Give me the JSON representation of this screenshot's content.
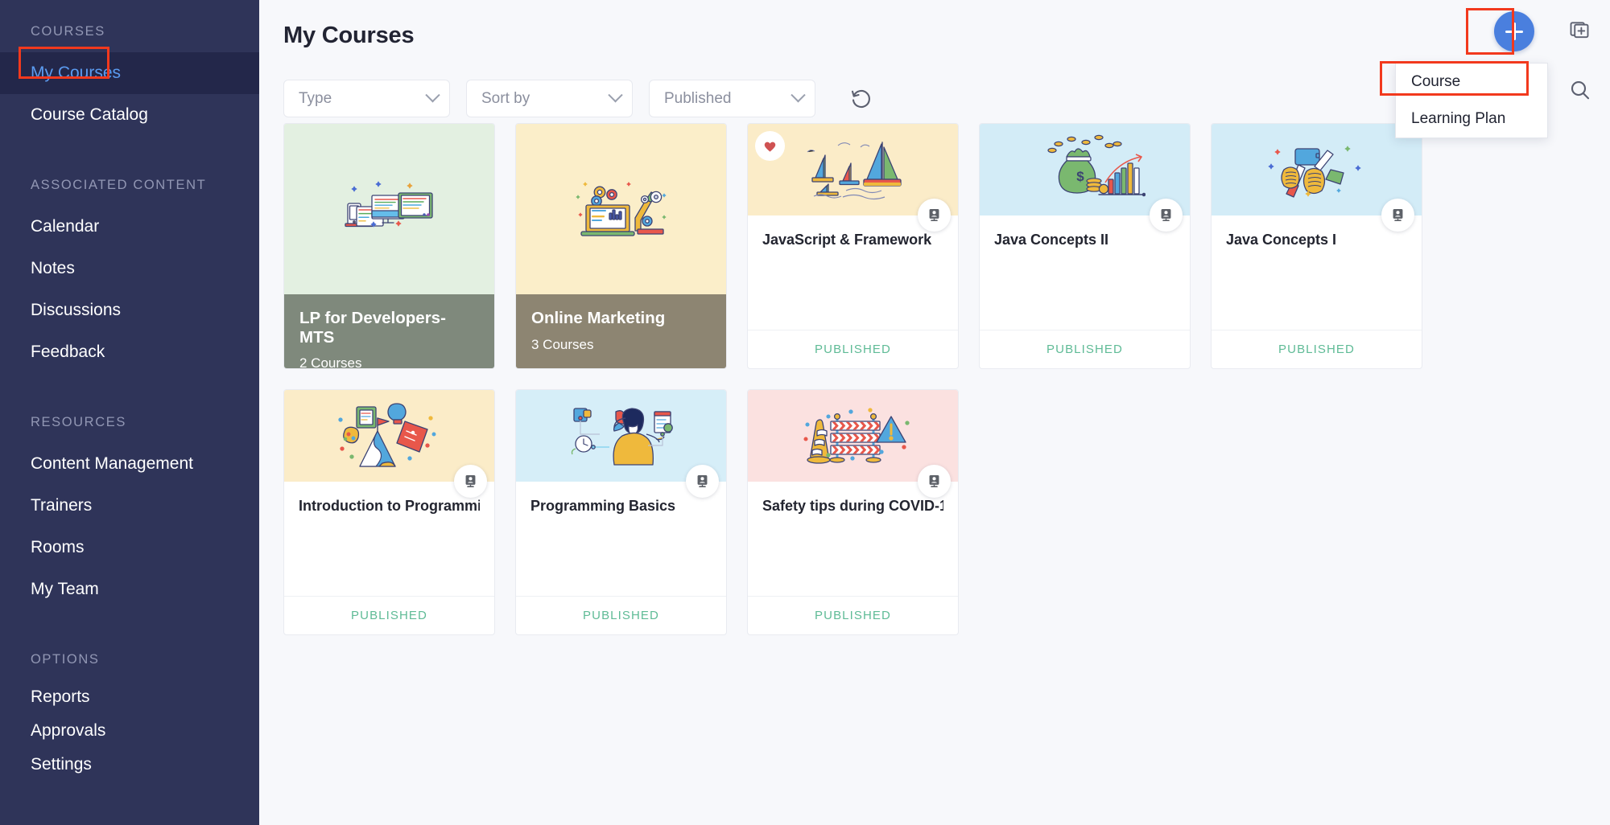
{
  "sidebar": {
    "groups": [
      {
        "label": "COURSES",
        "items": [
          {
            "label": "My Courses",
            "active": true
          },
          {
            "label": "Course Catalog",
            "active": false
          }
        ]
      },
      {
        "label": "ASSOCIATED CONTENT",
        "items": [
          {
            "label": "Calendar",
            "active": false
          },
          {
            "label": "Notes",
            "active": false
          },
          {
            "label": "Discussions",
            "active": false
          },
          {
            "label": "Feedback",
            "active": false
          }
        ]
      },
      {
        "label": "RESOURCES",
        "items": [
          {
            "label": "Content Management",
            "active": false
          },
          {
            "label": "Trainers",
            "active": false
          },
          {
            "label": "Rooms",
            "active": false
          },
          {
            "label": "My Team",
            "active": false
          }
        ]
      },
      {
        "label": "OPTIONS",
        "items": [
          {
            "label": "Reports",
            "active": false
          },
          {
            "label": "Approvals",
            "active": false
          },
          {
            "label": "Settings",
            "active": false
          }
        ]
      }
    ]
  },
  "header": {
    "title": "My Courses"
  },
  "filters": {
    "type": {
      "label": "Type",
      "icon": "chevron-down-icon"
    },
    "sort_by": {
      "label": "Sort by",
      "icon": "chevron-down-icon"
    },
    "published": {
      "label": "Published",
      "icon": "chevron-down-icon"
    },
    "reset": {
      "icon": "reset-icon"
    }
  },
  "fab": {
    "icon": "plus-icon",
    "menu": [
      {
        "label": "Course",
        "highlighted": true
      },
      {
        "label": "Learning Plan",
        "highlighted": false
      }
    ]
  },
  "right_rail": [
    {
      "icon": "add-to-collection-icon",
      "name": "add-to-collection-button"
    },
    {
      "icon": "search-icon",
      "name": "search-button"
    }
  ],
  "highlights": {
    "color": "#f2391d",
    "boxes": [
      "my-courses-nav-item",
      "add-button",
      "course-menu-item"
    ]
  },
  "colors": {
    "sidebar_bg": "#2f3459",
    "sidebar_active_bg": "#23274a",
    "sidebar_active_text": "#5b9bf0",
    "accent_blue": "#4a7fde",
    "published_green": "#5fbb96",
    "page_bg": "#f7f8fb",
    "highlight_red": "#f2391d"
  },
  "cards": [
    {
      "type": "learning-plan",
      "title": "LP for Developers-MTS",
      "subtitle": "2 Courses",
      "thumb_bg": "#e3f0e1",
      "footer_bg": "#7f897c",
      "illustration": "devices-illustration",
      "favorite": false,
      "classroom_badge": false,
      "status": null
    },
    {
      "type": "learning-plan",
      "title": "Online Marketing",
      "subtitle": "3 Courses",
      "thumb_bg": "#fbeec9",
      "footer_bg": "#8d8572",
      "illustration": "automation-illustration",
      "favorite": false,
      "classroom_badge": false,
      "status": null
    },
    {
      "type": "course",
      "title": "JavaScript & Framework",
      "subtitle": null,
      "thumb_bg": "#fbecc8",
      "footer_bg": null,
      "illustration": "sailboats-illustration",
      "favorite": true,
      "classroom_badge": true,
      "status": "PUBLISHED"
    },
    {
      "type": "course",
      "title": "Java Concepts II",
      "subtitle": null,
      "thumb_bg": "#d3ecf7",
      "footer_bg": null,
      "illustration": "money-growth-illustration",
      "favorite": false,
      "classroom_badge": true,
      "status": "PUBLISHED"
    },
    {
      "type": "course",
      "title": "Java Concepts I",
      "subtitle": null,
      "thumb_bg": "#d3ecf7",
      "footer_bg": null,
      "illustration": "tools-illustration",
      "favorite": false,
      "classroom_badge": true,
      "status": "PUBLISHED"
    },
    {
      "type": "course",
      "title": "Introduction to Programmi...",
      "subtitle": null,
      "thumb_bg": "#fbecc8",
      "footer_bg": null,
      "illustration": "learning-journey-illustration",
      "favorite": false,
      "classroom_badge": true,
      "status": "PUBLISHED"
    },
    {
      "type": "course",
      "title": "Programming Basics",
      "subtitle": null,
      "thumb_bg": "#d6eef8",
      "footer_bg": null,
      "illustration": "person-puzzle-illustration",
      "favorite": false,
      "classroom_badge": true,
      "status": "PUBLISHED"
    },
    {
      "type": "course",
      "title": "Safety tips during COVID-1...",
      "subtitle": null,
      "thumb_bg": "#fbe1e0",
      "footer_bg": null,
      "illustration": "roadblock-illustration",
      "favorite": false,
      "classroom_badge": true,
      "status": "PUBLISHED"
    }
  ]
}
